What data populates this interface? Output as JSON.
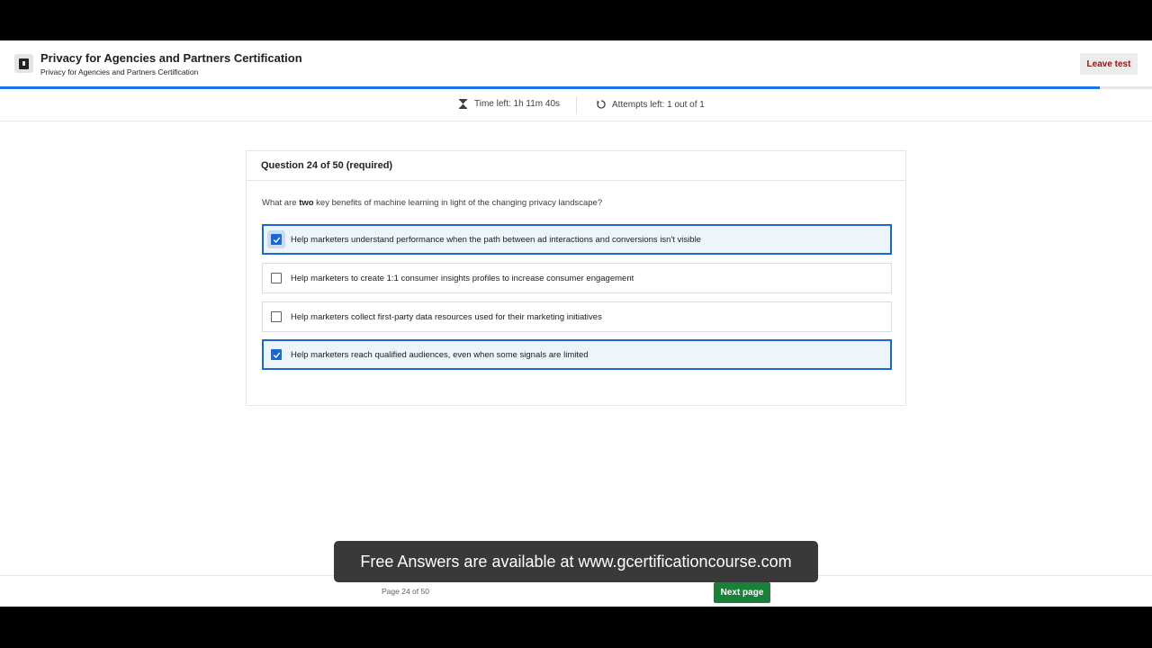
{
  "header": {
    "title": "Privacy for Agencies and Partners Certification",
    "subtitle": "Privacy for Agencies and Partners Certification",
    "leave_label": "Leave test",
    "course_icon": "book-icon"
  },
  "progress": {
    "fraction": 0.955
  },
  "status": {
    "time_left": "Time left: 1h 11m 40s",
    "attempts_left": "Attempts left: 1 out of 1",
    "time_icon": "hourglass-icon",
    "attempts_icon": "refresh-icon"
  },
  "question": {
    "header": "Question 24 of 50 (required)",
    "prompt_before": "What are ",
    "prompt_bold": "two",
    "prompt_after": " key benefits of machine learning in light of the changing privacy landscape?",
    "options": [
      {
        "label": "Help marketers understand performance when the path between ad interactions and conversions isn't visible",
        "checked": true
      },
      {
        "label": "Help marketers to create 1:1 consumer insights profiles to increase consumer engagement",
        "checked": false
      },
      {
        "label": "Help marketers collect first-party data resources used for their marketing initiatives",
        "checked": false
      },
      {
        "label": "Help marketers reach qualified audiences, even when some signals are limited",
        "checked": true
      }
    ]
  },
  "footer": {
    "page_indicator": "Page 24 of 50",
    "next_label": "Next page"
  },
  "overlay": {
    "text": "Free Answers are available at www.gcertificationcourse.com"
  },
  "colors": {
    "accent": "#1967d2",
    "next_button": "#188038",
    "leave_text": "#a50e0e"
  }
}
